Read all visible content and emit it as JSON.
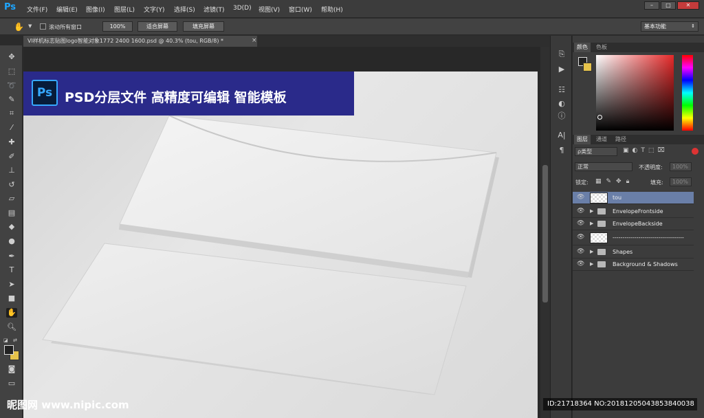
{
  "app": {
    "logo": "Ps",
    "menus": [
      "文件(F)",
      "编辑(E)",
      "图像(I)",
      "图层(L)",
      "文字(Y)",
      "选择(S)",
      "滤镜(T)",
      "3D(D)",
      "视图(V)",
      "窗口(W)",
      "帮助(H)"
    ],
    "window_buttons": [
      "–",
      "□",
      "✕"
    ]
  },
  "options_bar": {
    "scroll_all_label": "滚动所有窗口",
    "zoom_button": "100%",
    "fit_button": "适合屏幕",
    "fill_button": "填充屏幕",
    "workspace": "基本功能"
  },
  "document": {
    "tab_title": "VI样机标志贴图logo智能对象1772 2400 1600.psd @ 40.3% (tou, RGB/8) *",
    "tab_close": "×"
  },
  "banner": {
    "logo": "Ps",
    "text": "PSD分层文件  高精度可编辑 智能模板"
  },
  "color_panel": {
    "tabs": [
      "颜色",
      "色板"
    ]
  },
  "layers_panel": {
    "tabs": [
      "图层",
      "通道",
      "路径"
    ],
    "filter_label": "ρ类型",
    "blend_mode": "正常",
    "opacity_label": "不透明度:",
    "opacity_value": "100%",
    "lock_label": "锁定:",
    "fill_label": "填充:",
    "fill_value": "100%",
    "layers": [
      {
        "name": "tou",
        "type": "smart",
        "selected": true
      },
      {
        "name": "EnvelopeFrontside",
        "type": "group",
        "selected": false
      },
      {
        "name": "EnvelopeBackside",
        "type": "group",
        "selected": false
      },
      {
        "name": "------------------------------------",
        "type": "layer",
        "selected": false
      },
      {
        "name": "Shapes",
        "type": "group",
        "selected": false
      },
      {
        "name": "Background & Shadows",
        "type": "group",
        "selected": false
      }
    ]
  },
  "watermark": {
    "left": "昵图网 www.nipic.com",
    "right": "ID:21718364 NO:20181205043853840038"
  },
  "colors": {
    "accent": "#1ea6ff",
    "banner_bg": "#2a2a8a",
    "selected_layer": "#6a7fa8"
  }
}
